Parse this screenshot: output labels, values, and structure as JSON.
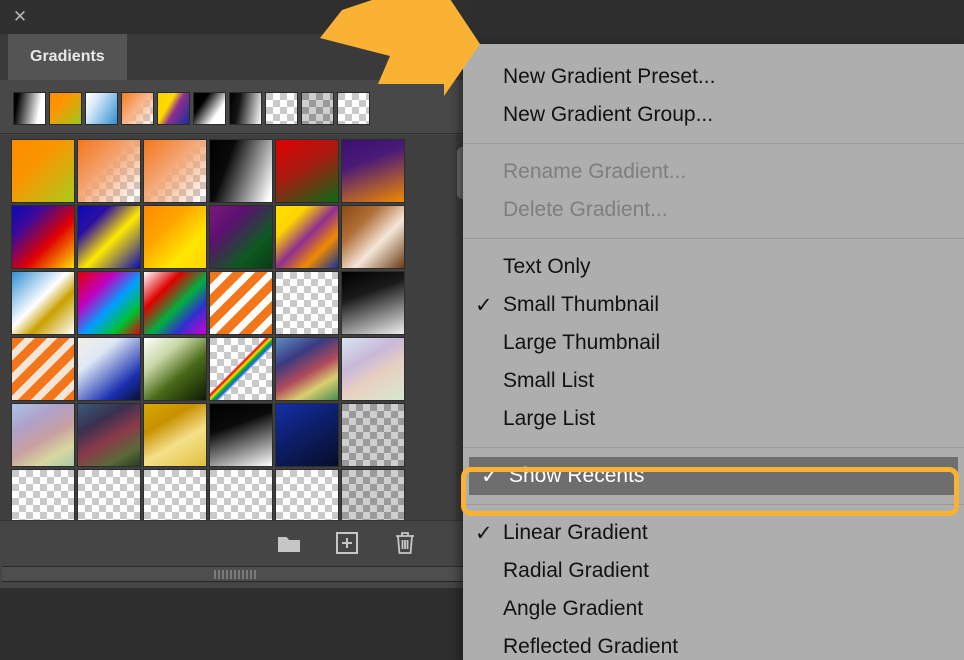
{
  "panel": {
    "title_tab": "Gradients",
    "close_icon": "close-icon",
    "collapse_icon": "double-chevron-left-icon",
    "menu_icon": "panel-menu-hamburger-icon",
    "footer_buttons": [
      {
        "name": "new-group-button",
        "icon": "folder-icon",
        "label": "New Group"
      },
      {
        "name": "new-preset-button",
        "icon": "new-preset-plus-icon",
        "label": "Create new gradient"
      },
      {
        "name": "delete-button",
        "icon": "trash-icon",
        "label": "Delete gradient"
      }
    ],
    "recents": [
      {
        "name": "recent-swatch-1",
        "css": "linear-gradient(100deg,#000 0%,#000 12%,#ffffff 78%,#ffffff 100%)"
      },
      {
        "name": "recent-swatch-2",
        "css": "linear-gradient(135deg,#ff8c00 0%,#ff9500 35%,#9ac81e 100%)"
      },
      {
        "name": "recent-swatch-3",
        "css": "linear-gradient(120deg,#ffffff 0%,#d8eaf8 30%,#2f8fd4 100%)"
      },
      {
        "name": "recent-swatch-4",
        "css": "linear-gradient(130deg,#f47f20 0%,#f8b082 45%,rgba(255,255,255,0) 100%)"
      },
      {
        "name": "recent-swatch-5",
        "css": "linear-gradient(120deg,#f5d400 0%,#ffd900 35%,#8e2f8e 55%,#13309c 100%)"
      },
      {
        "name": "recent-swatch-6",
        "css": "linear-gradient(125deg,#000 0%,#000 28%,#ffffff 72%,#ffffff 100%)"
      },
      {
        "name": "recent-swatch-7",
        "css": "linear-gradient(100deg,#000 0%,#151515 30%,#ffffff 100%)"
      },
      {
        "name": "recent-swatch-8",
        "css": "checker-light"
      },
      {
        "name": "recent-swatch-9",
        "css": "checker-dark"
      },
      {
        "name": "recent-swatch-10",
        "css": "checker-light"
      }
    ],
    "swatches": [
      {
        "name": "gradient-swatch-1",
        "css": "linear-gradient(135deg,#ff8a00 0%,#f99600 40%,#a8cc1c 100%)"
      },
      {
        "name": "gradient-swatch-2",
        "css": "linear-gradient(135deg,#f4761b 0%,#f3a06a 40%,rgba(255,255,255,0) 95%)"
      },
      {
        "name": "gradient-swatch-3",
        "css": "linear-gradient(135deg,#f4761b 0%,#f3a572 42%,rgba(255,255,255,0) 95%)"
      },
      {
        "name": "gradient-swatch-4",
        "css": "linear-gradient(110deg,#000000 0%,#0a0a0a 30%,#ffffff 95%)"
      },
      {
        "name": "gradient-swatch-5",
        "css": "linear-gradient(150deg,#e00000 0%,#a61b10 45%,#0a6b15 100%)"
      },
      {
        "name": "gradient-swatch-6",
        "css": "linear-gradient(160deg,#3a1070 0%,#4b1a78 35%,#f08a00 100%)"
      },
      {
        "name": "gradient-swatch-7",
        "css": "linear-gradient(135deg,#0a0ab4 0%,#3a0a9c 25%,#e00000 60%,#ffe000 100%)"
      },
      {
        "name": "gradient-swatch-8",
        "css": "linear-gradient(135deg,#0a0ab4 0%,#2b10a0 25%,#ffe800 55%,#0a0ab4 100%)"
      },
      {
        "name": "gradient-swatch-9",
        "css": "linear-gradient(135deg,#ff8a00 0%,#ffa400 35%,#ffe600 70%,#ffd400 100%)"
      },
      {
        "name": "gradient-swatch-10",
        "css": "linear-gradient(135deg,#7a1a7a 0%,#5c1070 30%,#0d5a20 70%,#0a3c14 100%)"
      },
      {
        "name": "gradient-swatch-11",
        "css": "linear-gradient(135deg,#ffe000 0%,#ffd400 25%,#8e2f8e 50%,#f08a00 72%,#10309c 100%)"
      },
      {
        "name": "gradient-swatch-12",
        "css": "linear-gradient(135deg,#8a4a10 0%,#b07038 30%,#f5e6d8 60%,#6b3a14 100%)"
      },
      {
        "name": "gradient-swatch-13",
        "css": "linear-gradient(135deg,#2f8fd4 0%,#ffffff 45%,#c9a000 65%,#ffffff 100%)"
      },
      {
        "name": "gradient-swatch-14",
        "css": "linear-gradient(135deg,#e00000 0%,#c000c0 30%,#00a0ff 55%,#00c030 78%,#e00000 100%)"
      },
      {
        "name": "gradient-swatch-15",
        "css": "linear-gradient(135deg,#ffffff 0%,#e00000 30%,#00b040 55%,#3030d0 75%,#d000d0 100%)"
      },
      {
        "name": "gradient-swatch-16",
        "css": "repeating-linear-gradient(135deg,#f4761b 0 9px,#ffffff 9px 16px)"
      },
      {
        "name": "gradient-swatch-17",
        "css": "checker-light"
      },
      {
        "name": "gradient-swatch-18",
        "css": "linear-gradient(160deg,#000000 0%,#1a1a1a 35%,#f0f0f0 100%)"
      },
      {
        "name": "gradient-swatch-19",
        "css": "repeating-linear-gradient(135deg,#f4761b 0 9px,#f3e6d6 9px 16px)"
      },
      {
        "name": "gradient-swatch-20",
        "css": "linear-gradient(140deg,#f4efe8 0%,#dfe8f5 30%,#1a2fb0 75%,#0a1030 100%)"
      },
      {
        "name": "gradient-swatch-21",
        "css": "linear-gradient(140deg,#ffffff 0%,#c9d8a8 30%,#4a6a18 60%,#0d1a05 100%)"
      },
      {
        "name": "gradient-swatch-22",
        "css": "checker-rainbow-diagonal"
      },
      {
        "name": "gradient-swatch-23",
        "css": "linear-gradient(150deg,#5a8ec4 0%,#3a3a80 30%,#b04a5a 55%,#d8d070 75%,#4a8a50 100%)"
      },
      {
        "name": "gradient-swatch-24",
        "css": "linear-gradient(150deg,#d8e4f0 0%,#c8b8d8 35%,#e8d0c0 60%,#d8e8d0 100%)"
      },
      {
        "name": "gradient-swatch-25",
        "css": "linear-gradient(150deg,#a8c4e4 0%,#b0a0c8 30%,#c8a0a0 55%,#d8d8a0 78%,#a8c8a8 100%)"
      },
      {
        "name": "gradient-swatch-26",
        "css": "linear-gradient(150deg,#3a5a78 0%,#3a3050 30%,#8a3a4a 55%,#5a6a3a 80%,#2a3a20 100%)"
      },
      {
        "name": "gradient-swatch-27",
        "css": "linear-gradient(150deg,#d8a800 0%,#c89000 30%,#f5e08a 60%,#e0c040 100%)"
      },
      {
        "name": "gradient-swatch-28",
        "css": "linear-gradient(160deg,#000000 0%,#0a0a0a 35%,#ffffff 100%)"
      },
      {
        "name": "gradient-swatch-29",
        "css": "linear-gradient(150deg,#1430a8 0%,#0d2070 40%,#060d28 100%)"
      },
      {
        "name": "gradient-swatch-30",
        "css": "checker-dark"
      },
      {
        "name": "gradient-swatch-31",
        "css": "checker-light"
      },
      {
        "name": "gradient-swatch-32",
        "css": "checker-light"
      },
      {
        "name": "gradient-swatch-33",
        "css": "checker-light"
      },
      {
        "name": "gradient-swatch-34",
        "css": "checker-light"
      },
      {
        "name": "gradient-swatch-35",
        "css": "checker-light"
      },
      {
        "name": "gradient-swatch-36",
        "css": "checker-dark"
      }
    ]
  },
  "context_menu": {
    "groups": [
      {
        "items": [
          {
            "label": "New Gradient Preset...",
            "check": "",
            "disabled": false,
            "highlight": false
          },
          {
            "label": "New Gradient Group...",
            "check": "",
            "disabled": false,
            "highlight": false
          }
        ]
      },
      {
        "items": [
          {
            "label": "Rename Gradient...",
            "check": "",
            "disabled": true,
            "highlight": false
          },
          {
            "label": "Delete Gradient...",
            "check": "",
            "disabled": true,
            "highlight": false
          }
        ]
      },
      {
        "items": [
          {
            "label": "Text Only",
            "check": "",
            "disabled": false,
            "highlight": false
          },
          {
            "label": "Small Thumbnail",
            "check": "✓",
            "disabled": false,
            "highlight": false
          },
          {
            "label": "Large Thumbnail",
            "check": "",
            "disabled": false,
            "highlight": false
          },
          {
            "label": "Small List",
            "check": "",
            "disabled": false,
            "highlight": false
          },
          {
            "label": "Large List",
            "check": "",
            "disabled": false,
            "highlight": false
          }
        ]
      },
      {
        "items": [
          {
            "label": "Show Recents",
            "check": "✓",
            "disabled": false,
            "highlight": true
          }
        ]
      },
      {
        "items": [
          {
            "label": "Linear Gradient",
            "check": "✓",
            "disabled": false,
            "highlight": false
          },
          {
            "label": "Radial Gradient",
            "check": "",
            "disabled": false,
            "highlight": false
          },
          {
            "label": "Angle Gradient",
            "check": "",
            "disabled": false,
            "highlight": false
          },
          {
            "label": "Reflected Gradient",
            "check": "",
            "disabled": false,
            "highlight": false
          }
        ]
      }
    ]
  },
  "annotations": {
    "arrow": {
      "name": "orange-pointer-arrow",
      "color": "#f9b233",
      "points_to": "panel-menu-hamburger-icon"
    },
    "highlight_ring": {
      "name": "orange-highlight-ring",
      "color": "#f9b233",
      "targets": "Show Recents"
    }
  },
  "colors": {
    "accent": "#f9b233",
    "panel_bg": "#454545",
    "menu_bg": "#aeaeae",
    "menu_highlight": "#6e6e6e"
  }
}
